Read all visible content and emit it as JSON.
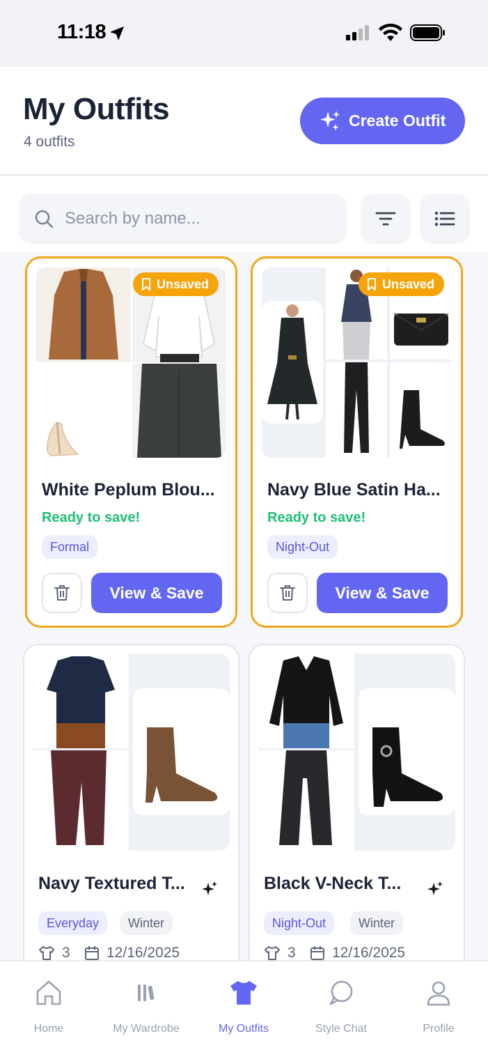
{
  "status_bar": {
    "time": "11:18"
  },
  "header": {
    "title": "My Outfits",
    "count": "4 outfits",
    "create_label": "Create Outfit"
  },
  "search": {
    "placeholder": "Search by name...",
    "value": ""
  },
  "cards": [
    {
      "title": "White Peplum Blou...",
      "badge": "Unsaved",
      "status": "Ready to save!",
      "tags": [
        "Formal"
      ],
      "action": "View & Save"
    },
    {
      "title": "Navy Blue Satin Ha...",
      "badge": "Unsaved",
      "status": "Ready to save!",
      "tags": [
        "Night-Out"
      ],
      "action": "View & Save"
    },
    {
      "title": "Navy Textured T...",
      "tags": [
        "Everyday",
        "Winter"
      ],
      "items": "3",
      "date": "12/16/2025"
    },
    {
      "title": "Black V-Neck T...",
      "tags": [
        "Night-Out",
        "Winter"
      ],
      "items": "3",
      "date": "12/16/2025"
    }
  ],
  "nav": {
    "items": [
      {
        "label": "Home",
        "icon": "home-icon"
      },
      {
        "label": "My Wardrobe",
        "icon": "wardrobe-icon"
      },
      {
        "label": "My Outfits",
        "icon": "tshirt-icon",
        "active": true
      },
      {
        "label": "Style Chat",
        "icon": "chat-icon"
      },
      {
        "label": "Profile",
        "icon": "profile-icon"
      }
    ]
  },
  "colors": {
    "accent": "#6366f1",
    "unsaved": "#f5a40c",
    "ready": "#1fbf74"
  }
}
